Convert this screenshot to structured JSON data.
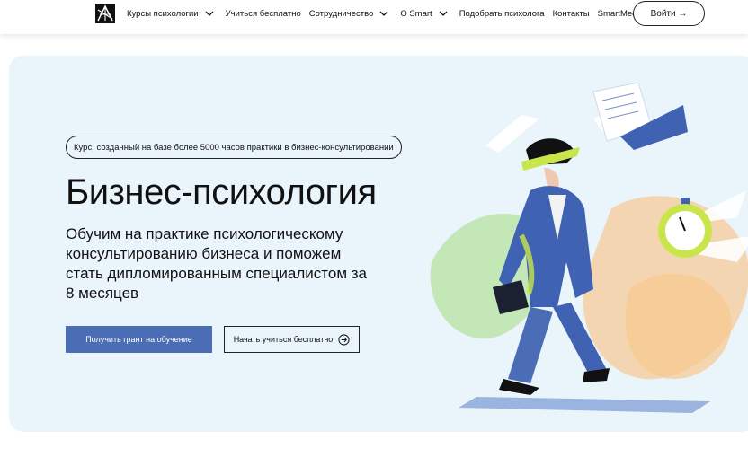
{
  "header": {
    "nav": [
      {
        "label": "Курсы психологии",
        "has_dropdown": true
      },
      {
        "label": "Учиться бесплатно",
        "has_dropdown": false
      },
      {
        "label": "Сотрудничество",
        "has_dropdown": true
      },
      {
        "label": "О Smart",
        "has_dropdown": true
      },
      {
        "label": "Подобрать психолога",
        "has_dropdown": false
      },
      {
        "label": "Контакты",
        "has_dropdown": false
      },
      {
        "label": "SmartMedia",
        "has_dropdown": true
      }
    ],
    "login_label": "Войти →"
  },
  "hero": {
    "badge": "Курс, созданный на базе более 5000 часов практики в бизнес-консультировании",
    "title": "Бизнес-психология",
    "subtitle": "Обучим на практике психологическому консультированию бизнеса и поможем стать дипломированным специалистом за 8 месяцев",
    "primary_button": "Получить грант на обучение",
    "secondary_button": "Начать учиться бесплатно"
  },
  "colors": {
    "hero_bg": "#eaf4fb",
    "primary": "#4a6db5",
    "accent_green": "#c8e64b",
    "figure_blue": "#3f63b2"
  },
  "icons": [
    "logo-icon",
    "chevron-down-icon",
    "arrow-right-circle-icon",
    "stopwatch-icon"
  ]
}
